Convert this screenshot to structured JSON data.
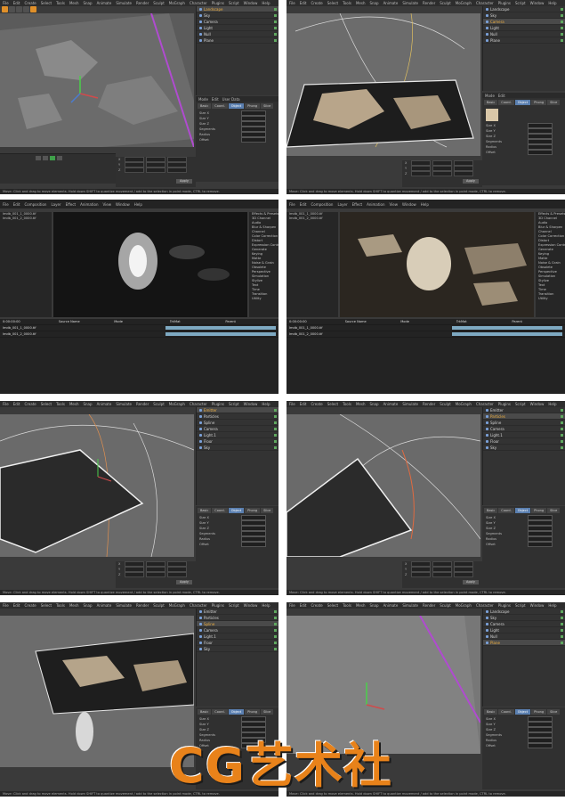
{
  "c4d_menu": [
    "File",
    "Edit",
    "Create",
    "Select",
    "Tools",
    "Mesh",
    "Snap",
    "Animate",
    "Simulate",
    "Render",
    "Sculpt",
    "MoGraph",
    "Character",
    "Plugins",
    "Script",
    "Window",
    "Help"
  ],
  "ae_menu": [
    "File",
    "Edit",
    "Composition",
    "Layer",
    "Effect",
    "Animation",
    "View",
    "Window",
    "Help"
  ],
  "objects_a": [
    "Landscape",
    "Sky",
    "Camera",
    "Light",
    "Null",
    "Plane"
  ],
  "objects_b": [
    "Emitter",
    "Particles",
    "Spline",
    "Camera",
    "Light.1",
    "Floor",
    "Sky"
  ],
  "attr_tabs": [
    "Basic",
    "Coord.",
    "Object",
    "Phong",
    "Slice"
  ],
  "attr_props": [
    "Size X",
    "Size Y",
    "Size Z",
    "Segments",
    "Radius",
    "Offset"
  ],
  "ae_project_items": [
    "lmdb_001_1_0000.tif",
    "lmdb_001_2_0000.tif"
  ],
  "ae_effects_items": [
    "Effects & Presets",
    "3D Channel",
    "Audio",
    "Blur & Sharpen",
    "Channel",
    "Color Correction",
    "Distort",
    "Expression Controls",
    "Generate",
    "Keying",
    "Matte",
    "Noise & Grain",
    "Obsolete",
    "Perspective",
    "Simulation",
    "Stylize",
    "Text",
    "Time",
    "Transition",
    "Utility"
  ],
  "ae_timeline_labels": [
    "0:00:00:00",
    "Source Name",
    "Mode",
    "TrkMat",
    "Parent"
  ],
  "coord_labels": [
    "X",
    "Y",
    "Z"
  ],
  "apply_label": "Apply",
  "status_text": "Move: Click and drag to move elements. Hold down SHIFT to quantize movement / add to the selection in point mode, CTRL to remove.",
  "watermark": "CG艺术社",
  "accent": "#e0902a"
}
